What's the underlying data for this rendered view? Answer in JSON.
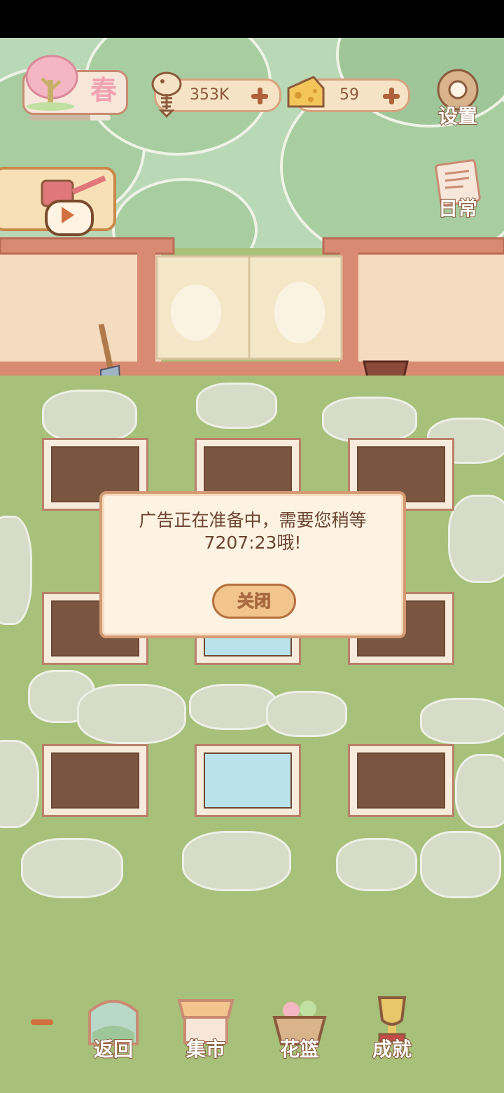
{
  "season": {
    "label": "春",
    "progress": 0.75
  },
  "currency": {
    "fish": {
      "value": "353K"
    },
    "cheese": {
      "value": "59"
    }
  },
  "side_buttons": {
    "settings": "设置",
    "daily": "日常",
    "expand": "扩建"
  },
  "dialog": {
    "message": "广告正在准备中，需要您稍等7207:23哦!",
    "close_label": "关闭"
  },
  "nav": {
    "back": "返回",
    "market": "集市",
    "basket": "花篮",
    "achievements": "成就"
  },
  "plots": [
    {
      "row": 1,
      "col": 1,
      "state": "soil"
    },
    {
      "row": 1,
      "col": 2,
      "state": "soil"
    },
    {
      "row": 1,
      "col": 3,
      "state": "soil"
    },
    {
      "row": 2,
      "col": 1,
      "state": "soil"
    },
    {
      "row": 2,
      "col": 2,
      "state": "water"
    },
    {
      "row": 2,
      "col": 3,
      "state": "soil"
    },
    {
      "row": 3,
      "col": 1,
      "state": "soil"
    },
    {
      "row": 3,
      "col": 2,
      "state": "water"
    },
    {
      "row": 3,
      "col": 3,
      "state": "soil"
    }
  ],
  "colors": {
    "dialog_border": "#d49a73",
    "text_brown": "#6b4430",
    "ground": "#a7c07a"
  }
}
